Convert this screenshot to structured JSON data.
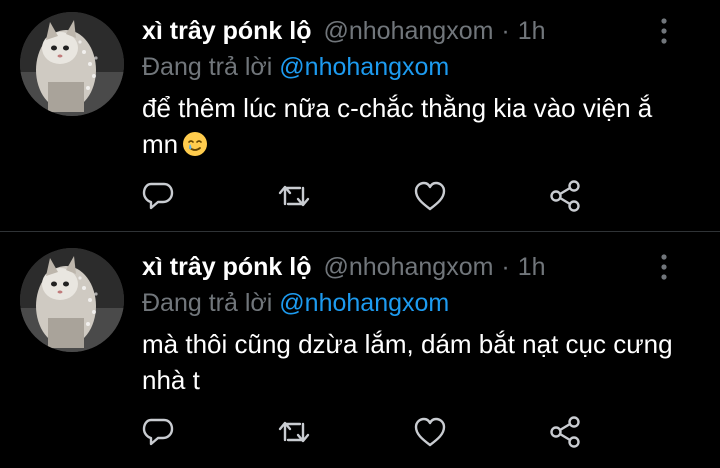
{
  "tweets": [
    {
      "name": "xì trây pónk lộ",
      "handle": "@nhohangxom",
      "separator": "·",
      "time": "1h",
      "reply_prefix": "Đang trả lời",
      "reply_to": "@nhohangxom",
      "text": "để thêm lúc nữa c-chắc thằng kia vào viện ắ mn",
      "emoji": "smiling-face-with-tear"
    },
    {
      "name": "xì trây pónk lộ",
      "handle": "@nhohangxom",
      "separator": "·",
      "time": "1h",
      "reply_prefix": "Đang trả lời",
      "reply_to": "@nhohangxom",
      "text": "mà thôi cũng dzừa lắm, dám bắt nạt cục cưng nhà t"
    }
  ],
  "actions": [
    "reply-icon",
    "retweet-icon",
    "like-icon",
    "share-icon"
  ],
  "colors": {
    "background": "#000000",
    "text": "#ffffff",
    "muted": "#71767b",
    "link": "#1d9bf0",
    "divider": "#2f3336"
  }
}
